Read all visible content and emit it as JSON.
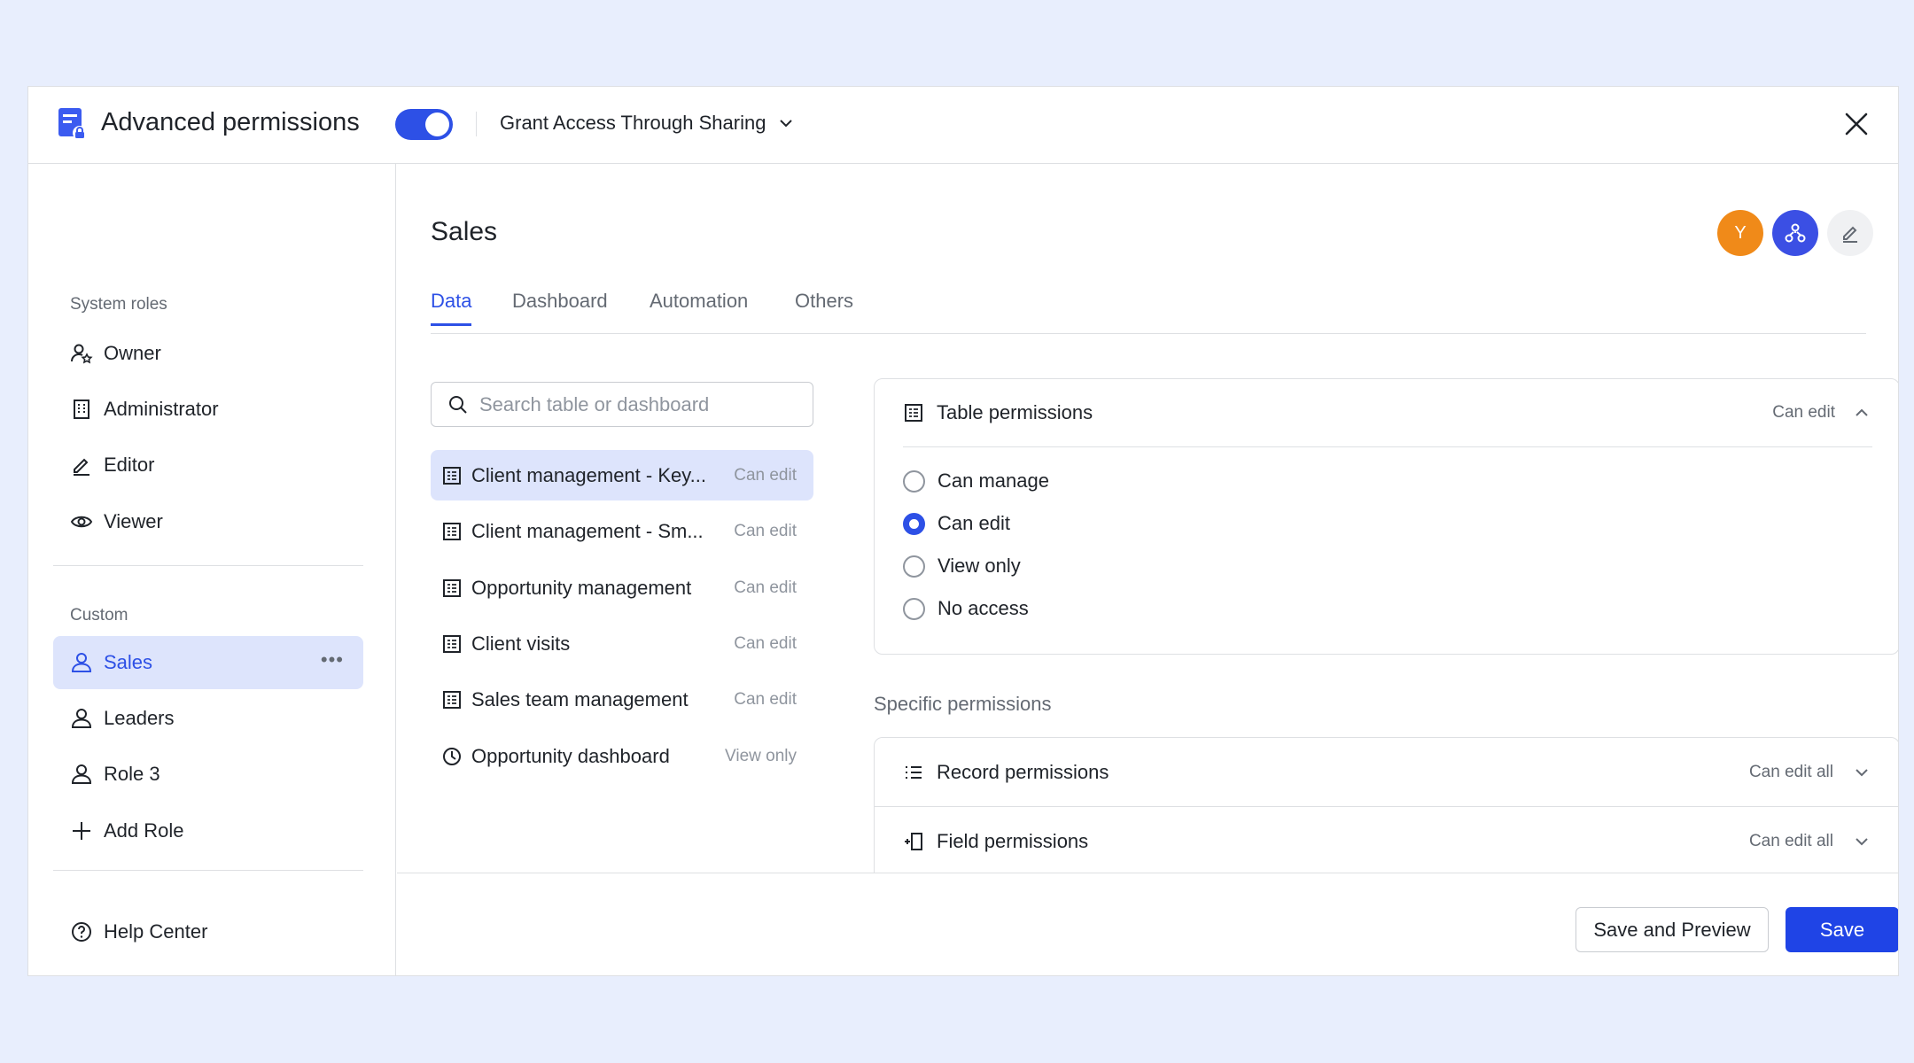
{
  "header": {
    "title": "Advanced permissions",
    "toggle_on": true,
    "grant_label": "Grant Access Through Sharing"
  },
  "sidebar": {
    "system_label": "System roles",
    "system_roles": [
      {
        "label": "Owner",
        "icon": "owner-icon"
      },
      {
        "label": "Administrator",
        "icon": "building-icon"
      },
      {
        "label": "Editor",
        "icon": "pencil-icon"
      },
      {
        "label": "Viewer",
        "icon": "eye-icon"
      }
    ],
    "custom_label": "Custom",
    "custom_roles": [
      {
        "label": "Sales",
        "icon": "user-icon",
        "active": true
      },
      {
        "label": "Leaders",
        "icon": "user-icon"
      },
      {
        "label": "Role 3",
        "icon": "user-icon"
      }
    ],
    "add_role": "Add Role",
    "help": "Help Center"
  },
  "main": {
    "role_title": "Sales",
    "avatar_initial": "Y",
    "tabs": [
      "Data",
      "Dashboard",
      "Automation",
      "Others"
    ],
    "active_tab": "Data",
    "search_placeholder": "Search table or dashboard",
    "tables": [
      {
        "name": "Client management - Key...",
        "perm": "Can edit",
        "icon": "table-icon",
        "active": true
      },
      {
        "name": "Client management - Sm...",
        "perm": "Can edit",
        "icon": "table-icon"
      },
      {
        "name": "Opportunity management",
        "perm": "Can edit",
        "icon": "table-icon"
      },
      {
        "name": "Client visits",
        "perm": "Can edit",
        "icon": "table-icon"
      },
      {
        "name": "Sales team management",
        "perm": "Can edit",
        "icon": "table-icon"
      },
      {
        "name": "Opportunity dashboard",
        "perm": "View only",
        "icon": "dashboard-icon"
      }
    ],
    "table_permissions": {
      "label": "Table permissions",
      "value": "Can edit",
      "options": [
        "Can manage",
        "Can edit",
        "View only",
        "No access"
      ],
      "selected": "Can edit"
    },
    "specific_label": "Specific permissions",
    "record_permissions": {
      "label": "Record permissions",
      "value": "Can edit all"
    },
    "field_permissions": {
      "label": "Field permissions",
      "value": "Can edit all"
    }
  },
  "footer": {
    "preview_label": "Save and Preview",
    "save_label": "Save"
  },
  "colors": {
    "accent": "#2d50e6",
    "background": "#e8eefd",
    "avatar_orange": "#f08a19"
  }
}
